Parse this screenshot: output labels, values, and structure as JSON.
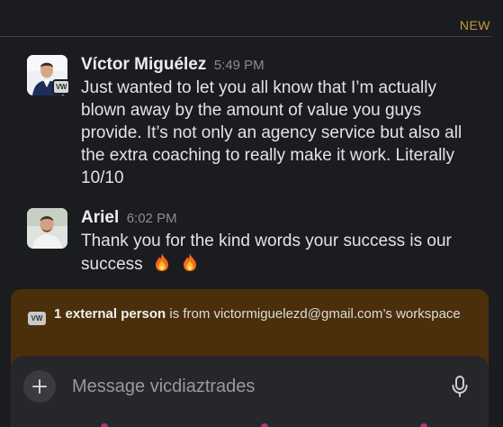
{
  "divider": {
    "label": "NEW"
  },
  "messages": [
    {
      "author": "Víctor Miguélez",
      "time": "5:49 PM",
      "avatar_badge": "VW",
      "text": "Just wanted to let you all know that I’m actually blown away by the amount of value you guys provide. It’s not only an agency service but also all the extra coaching to really make it work. Literally 10/10"
    },
    {
      "author": "Ariel",
      "time": "6:02 PM",
      "text": "Thank you for the kind words your success is our success",
      "emoji": [
        "fire",
        "fire"
      ]
    }
  ],
  "external_notice": {
    "icon_label": "VW",
    "count_text": "1 external person",
    "rest_text": " is from victormiguelezd@gmail.com’s workspace"
  },
  "composer": {
    "placeholder": "Message vicdiaztrades",
    "value": ""
  },
  "colors": {
    "background": "#1b1c1f",
    "accent_new": "#c79a3b",
    "external_banner": "#4b2f0b",
    "composer": "#26272a"
  },
  "icons": {
    "add": "plus-icon",
    "voice": "microphone-icon",
    "reaction": "fire-emoji"
  }
}
